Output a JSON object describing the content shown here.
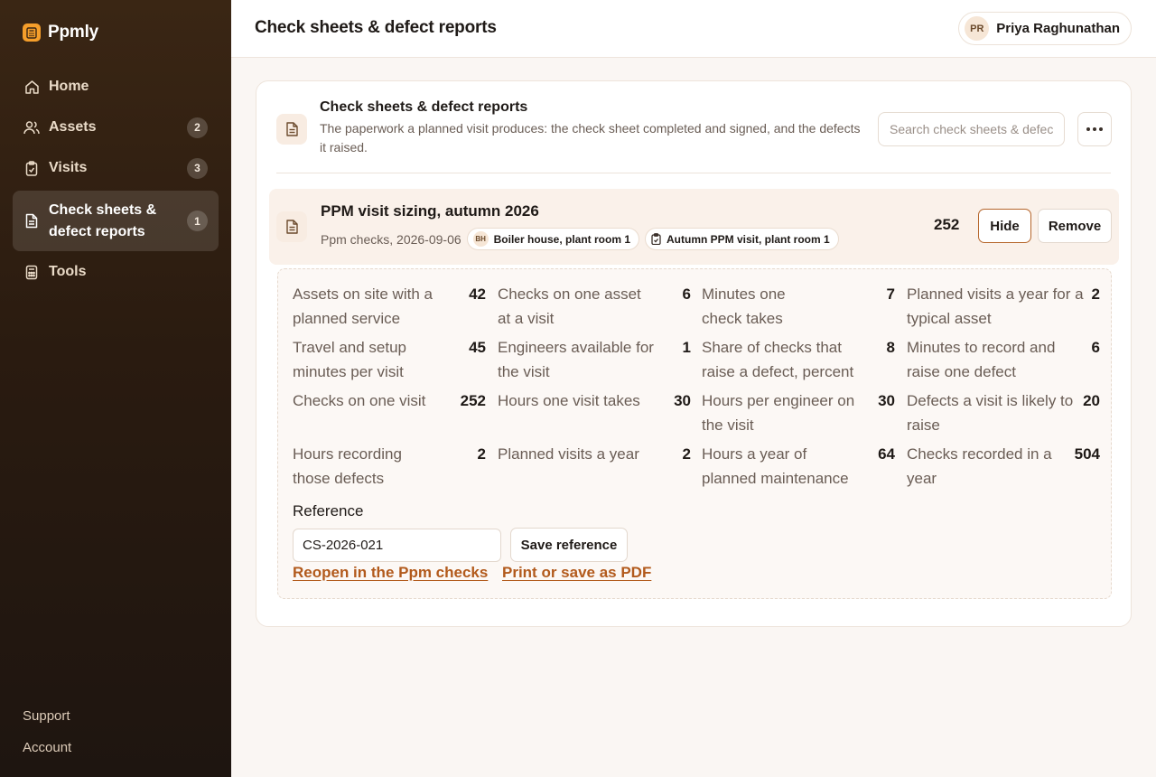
{
  "brand": {
    "name": "Ppmly",
    "logo_icon": "calculator-icon",
    "accent": "#f59e2b"
  },
  "sidebar": {
    "items": [
      {
        "label": "Home",
        "icon": "home-icon",
        "badge": null
      },
      {
        "label": "Assets",
        "icon": "users-icon",
        "badge": "2"
      },
      {
        "label": "Visits",
        "icon": "clipboard-icon",
        "badge": "3"
      },
      {
        "label": "Check sheets & defect reports",
        "icon": "document-icon",
        "badge": "1",
        "active": true
      },
      {
        "label": "Tools",
        "icon": "calculator-icon",
        "badge": null
      }
    ],
    "footer": {
      "support": "Support",
      "account": "Account"
    }
  },
  "header": {
    "title": "Check sheets & defect reports",
    "user": {
      "initials": "PR",
      "name": "Priya Raghunathan"
    }
  },
  "section": {
    "title": "Check sheets & defect reports",
    "description": "The paperwork a planned visit produces: the check sheet completed and signed, and the defects it raised.",
    "search_placeholder": "Search check sheets & defect reports",
    "more_icon": "more-horizontal-icon"
  },
  "report": {
    "title": "PPM visit sizing, autumn 2026",
    "meta": "Ppm checks, 2026-09-06",
    "chips": [
      {
        "initials": "BH",
        "label": "Boiler house, plant room 1"
      },
      {
        "icon": "clipboard-icon",
        "label": "Autumn PPM visit, plant room 1"
      }
    ],
    "count": "252",
    "hide_label": "Hide",
    "remove_label": "Remove",
    "hide_border": "#b5652a"
  },
  "metrics": [
    {
      "label": "Assets on site with a planned service",
      "value": "42"
    },
    {
      "label": "Checks on one asset at a visit",
      "value": "6"
    },
    {
      "label": "Minutes one check takes",
      "value": "7"
    },
    {
      "label": "Planned visits a year for a typical asset",
      "value": "2"
    },
    {
      "label": "Travel and setup minutes per visit",
      "value": "45"
    },
    {
      "label": "Engineers available for the visit",
      "value": "1"
    },
    {
      "label": "Share of checks that raise a defect, percent",
      "value": "8"
    },
    {
      "label": "Minutes to record and raise one defect",
      "value": "6"
    },
    {
      "label": "Checks on one visit",
      "value": "252"
    },
    {
      "label": "Hours one visit takes",
      "value": "30"
    },
    {
      "label": "Hours per engineer on the visit",
      "value": "30"
    },
    {
      "label": "Defects a visit is likely to raise",
      "value": "20"
    },
    {
      "label": "Hours recording those defects",
      "value": "2"
    },
    {
      "label": "Planned visits a year",
      "value": "2"
    },
    {
      "label": "Hours a year of planned maintenance",
      "value": "64"
    },
    {
      "label": "Checks recorded in a year",
      "value": "504"
    }
  ],
  "reference": {
    "label": "Reference",
    "value": "CS-2026-021",
    "save_label": "Save reference",
    "reopen_link": "Reopen in the Ppm checks",
    "pdf_link": "Print or save as PDF",
    "link_color": "#b25a1c"
  }
}
